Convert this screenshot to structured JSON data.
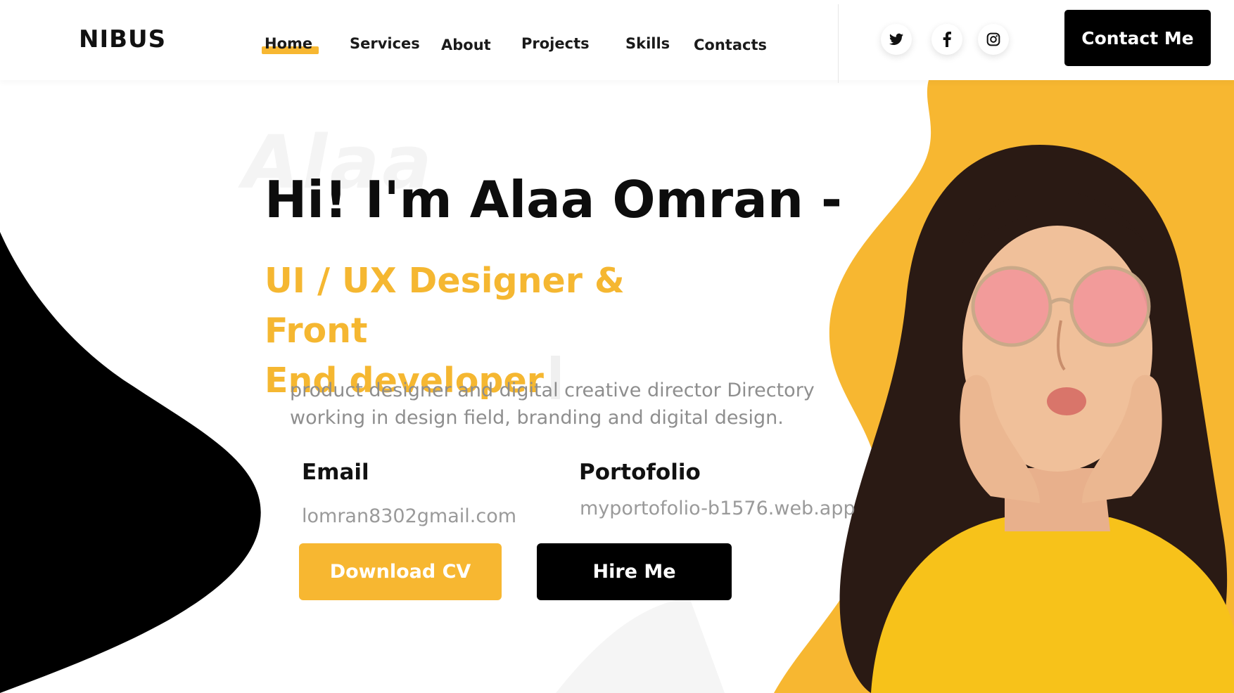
{
  "header": {
    "logo": "NIBUS",
    "nav": [
      {
        "label": "Home",
        "active": true
      },
      {
        "label": "Services"
      },
      {
        "label": "About"
      },
      {
        "label": "Projects"
      },
      {
        "label": "Skills"
      },
      {
        "label": "Contacts"
      }
    ],
    "social": [
      "twitter-icon",
      "facebook-icon",
      "instagram-icon"
    ],
    "contact_button": "Contact Me"
  },
  "hero": {
    "background_word": "Alaa",
    "heading": "Hi! I'm Alaa Omran -",
    "role_line1": "UI / UX Designer & Front",
    "role_line2": "End developer",
    "description_line1": "product designer and digital creative director Directory",
    "description_line2": "working in design field, branding and digital design.",
    "email_label": "Email",
    "email_value": "lomran8302gmail.com",
    "portfolio_label": "Portofolio",
    "portfolio_value": "myportofolio-b1576.web.app",
    "download_button": "Download CV",
    "hire_button": "Hire Me"
  },
  "colors": {
    "accent": "#f7b731",
    "dark": "#000000",
    "muted_text": "#8e8e8e"
  }
}
